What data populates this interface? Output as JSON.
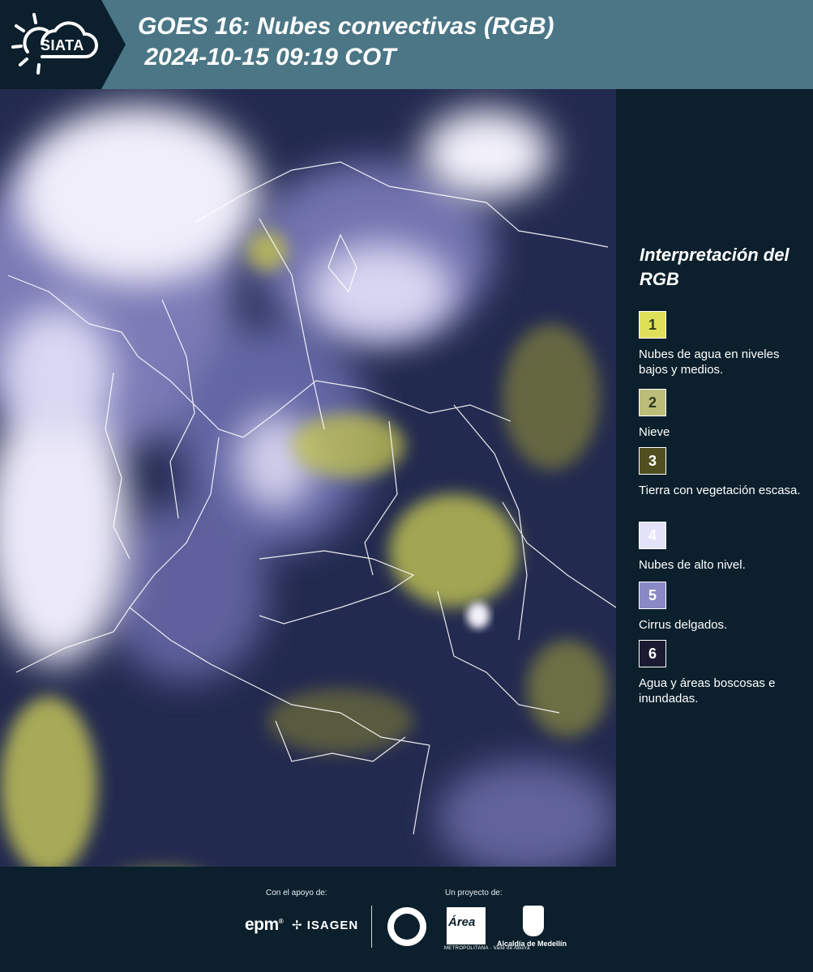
{
  "header": {
    "logo_text": "SIATA",
    "title": "GOES 16: Nubes convectivas (RGB)\n 2024-10-15 09:19 COT"
  },
  "map": {
    "description_icon": "satellite-map",
    "colors": {
      "background": "#232a4f",
      "high_cloud": "#e8e6f6",
      "cirrus": "#8a89c8",
      "low_cloud": "#d7d85f",
      "borders": "#ffffff"
    }
  },
  "legend": {
    "title": "Interpretación del RGB",
    "items": [
      {
        "number": "1",
        "color": "#dfe05a",
        "label": "Nubes de agua en niveles bajos y medios."
      },
      {
        "number": "2",
        "color": "#bdbd7a",
        "label": "Nieve"
      },
      {
        "number": "3",
        "color": "#4f4f1f",
        "label": "Tierra con vegetación escasa."
      },
      {
        "number": "4",
        "color": "#e3e2f7",
        "label": "Nubes de alto nivel."
      },
      {
        "number": "5",
        "color": "#8889c5",
        "label": "Cirrus delgados."
      },
      {
        "number": "6",
        "color": "#1a1a33",
        "label": "Agua y áreas boscosas e inundadas."
      }
    ]
  },
  "footer": {
    "support_label": "Con el apoyo de:",
    "project_label": "Un proyecto de:",
    "epm": "epm",
    "isagen": "ISAGEN",
    "area_logo": "Área",
    "area_sub": "METROPOLITANA · Valle de Aburrá",
    "alcaldia": "Alcaldía de Medellín"
  }
}
